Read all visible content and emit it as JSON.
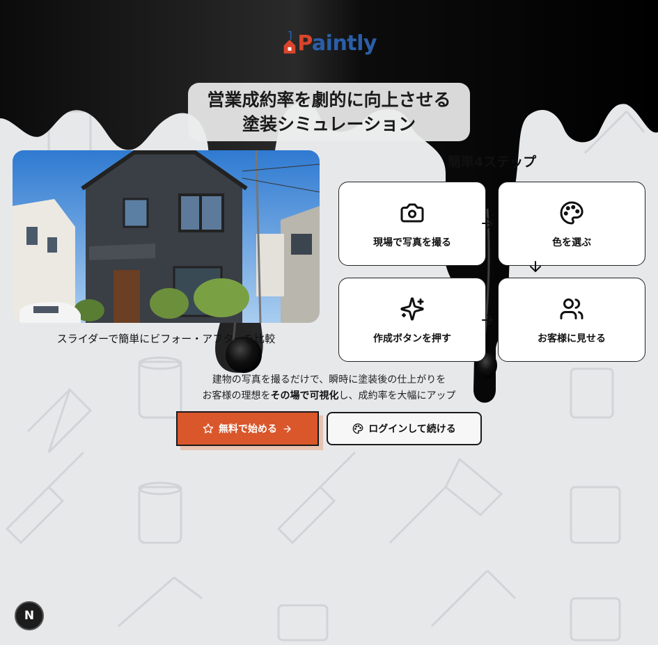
{
  "brand": {
    "logo_text_first": "P",
    "logo_text_rest": "aintly",
    "logo_icon": "house-paint-icon",
    "primary_color": "#d9572b",
    "secondary_color": "#2a5fa9"
  },
  "hero": {
    "headline_line1": "営業成約率を劇的に向上させる",
    "headline_line2": "塗装シミュレーション",
    "image_alt": "house-photo",
    "slider_caption": "スライダーで簡単にビフォー・アフターを比較"
  },
  "steps": {
    "title": "簡単4ステップ",
    "items": [
      {
        "label": "現場で写真を撮る",
        "icon": "camera-icon"
      },
      {
        "label": "色を選ぶ",
        "icon": "palette-icon"
      },
      {
        "label": "作成ボタンを押す",
        "icon": "sparkles-icon"
      },
      {
        "label": "お客様に見せる",
        "icon": "users-icon"
      }
    ]
  },
  "description": {
    "line1": "建物の写真を撮るだけで、瞬時に塗装後の仕上がりを",
    "line2_pre": "お客様の理想を",
    "line2_bold": "その場で可視化",
    "line2_post": "し、成約率を大幅にアップ"
  },
  "actions": {
    "primary_label": "無料で始める",
    "secondary_label": "ログインして続ける"
  },
  "dev_badge": {
    "label": "N"
  }
}
